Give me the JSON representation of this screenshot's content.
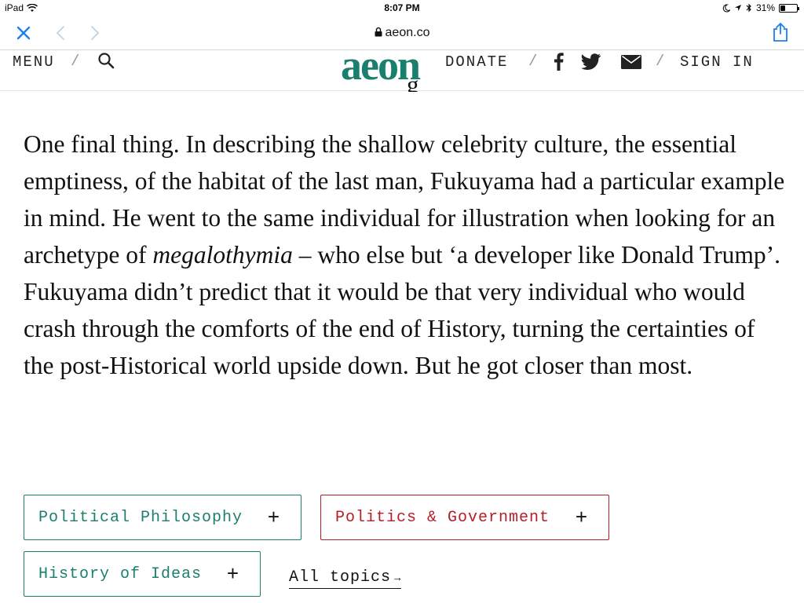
{
  "status_bar": {
    "device": "iPad",
    "time": "8:07 PM",
    "battery": "31%",
    "battery_level": 0.31
  },
  "browser": {
    "url": "aeon.co"
  },
  "site_nav": {
    "menu": "MENU",
    "separator": "/",
    "logo": "aeon",
    "donate": "DONATE",
    "sign_in": "SIGN IN",
    "accent_color": "#1b7f6e"
  },
  "article": {
    "text_before": "One final thing. In describing the shallow celebrity culture, the essential emptiness, of the habitat of the last man, Fukuyama had a particular example in mind. He went to the same individual for illustration when looking for an archetype of",
    "italic_word": "megalothymia",
    "text_after": " – who else but ‘a developer like Donald Trump’. Fukuyama didn’t predict that it would be that very individual who would crash through the comforts of the end of History, turning the certainties of the post-Historical world upside down. But he got closer than most."
  },
  "topics": {
    "tags": [
      {
        "label": "Political Philosophy",
        "color": "#1b7f6e"
      },
      {
        "label": "Politics & Government",
        "color": "#b81c26"
      },
      {
        "label": "History of Ideas",
        "color": "#1b7f6e"
      }
    ],
    "plus": "+",
    "all_topics": "All topics",
    "arrow": "→"
  }
}
